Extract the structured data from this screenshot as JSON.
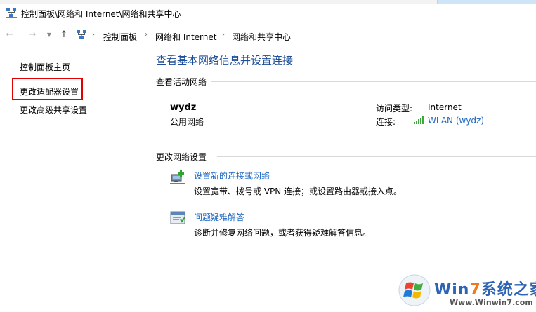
{
  "window": {
    "title": "控制面板\\网络和 Internet\\网络和共享中心"
  },
  "address_bar": {
    "crumbs": [
      "控制面板",
      "网络和 Internet",
      "网络和共享中心"
    ],
    "separator": "›"
  },
  "nav": {
    "back_icon": "back-arrow-icon",
    "forward_icon": "forward-arrow-icon",
    "recent_icon": "chevron-down-icon",
    "up_icon": "up-arrow-icon"
  },
  "sidebar": {
    "items": [
      {
        "label": "控制面板主页"
      },
      {
        "label": "更改适配器设置"
      },
      {
        "label": "更改高级共享设置"
      }
    ],
    "highlight_color": "#e00000"
  },
  "main": {
    "heading": "查看基本网络信息并设置连接",
    "active_networks": {
      "section_label": "查看活动网络",
      "network_name": "wydz",
      "network_type": "公用网络",
      "access_type_label": "访问类型:",
      "access_type_value": "Internet",
      "connection_label": "连接:",
      "connection_value": "WLAN (wydz)"
    },
    "change_settings": {
      "section_label": "更改网络设置",
      "tasks": [
        {
          "link": "设置新的连接或网络",
          "desc": "设置宽带、拨号或 VPN 连接；或设置路由器或接入点。",
          "icon": "new-connection-icon"
        },
        {
          "link": "问题疑难解答",
          "desc": "诊断并修复网络问题，或者获得疑难解答信息。",
          "icon": "troubleshoot-icon"
        }
      ]
    }
  },
  "watermark": {
    "title_part1": "Win",
    "title_part2": "7",
    "title_part3": "系统之家",
    "url": "Www.Winwin7.com"
  },
  "colors": {
    "link": "#1a66c2",
    "heading": "#1e4e99",
    "wm_blue": "#2d64b3",
    "wm_orange": "#f07a1a"
  }
}
